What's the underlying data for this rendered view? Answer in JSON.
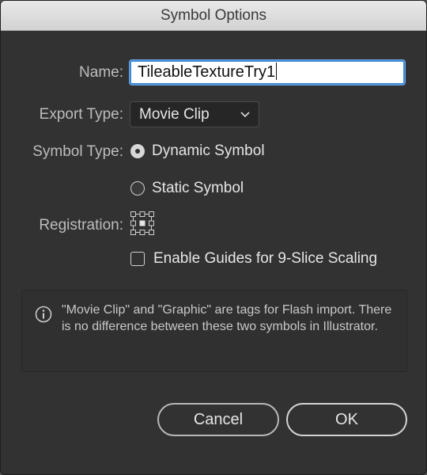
{
  "dialog": {
    "title": "Symbol Options"
  },
  "form": {
    "name_label": "Name:",
    "name_value": "TileableTextureTry1",
    "export_type_label": "Export Type:",
    "export_type_value": "Movie Clip",
    "symbol_type_label": "Symbol Type:",
    "symbol_type_options": [
      {
        "label": "Dynamic Symbol",
        "selected": true
      },
      {
        "label": "Static Symbol",
        "selected": false
      }
    ],
    "registration_label": "Registration:",
    "registration_icon": "registration-grid-icon",
    "guides_label": "Enable Guides for 9-Slice Scaling",
    "guides_checked": false
  },
  "info": {
    "icon": "info-icon",
    "text": "\"Movie Clip\" and \"Graphic\" are tags for Flash import. There is no difference between these two symbols in Illustrator."
  },
  "buttons": {
    "cancel": "Cancel",
    "ok": "OK"
  },
  "colors": {
    "background": "#323232",
    "focus_ring": "#3d87d5",
    "text": "#e6e6e6",
    "label_text": "#bdbdbd"
  }
}
